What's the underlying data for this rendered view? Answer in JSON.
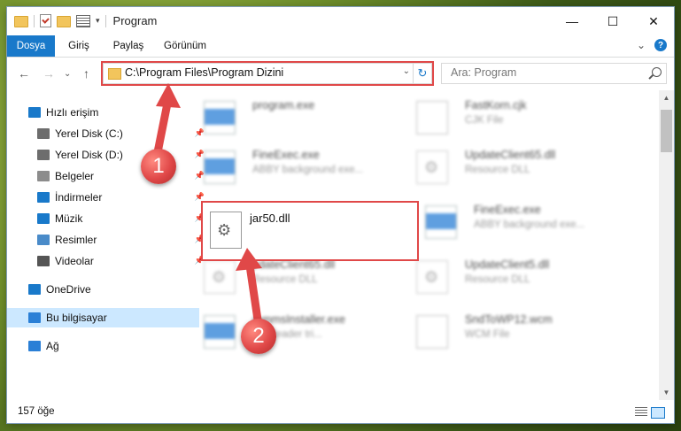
{
  "window": {
    "title": "Program",
    "controls": {
      "minimize": "—",
      "maximize": "☐",
      "close": "✕"
    }
  },
  "ribbon": {
    "tabs": [
      "Dosya",
      "Giriş",
      "Paylaş",
      "Görünüm"
    ],
    "active_tab": "Dosya",
    "expand_glyph": "⌄",
    "help_glyph": "?"
  },
  "navigation": {
    "back": "←",
    "forward": "→",
    "recent": "⌄",
    "up": "↑",
    "address": "C:\\Program Files\\Program Dizini",
    "address_drop": "⌄",
    "refresh": "↻",
    "search_placeholder": "Ara: Program"
  },
  "sidebar": {
    "items": [
      {
        "label": "Hızlı erişim",
        "icon": "star-icon",
        "color": "#1979ca",
        "pinned": false
      },
      {
        "label": "Yerel Disk (C:)",
        "icon": "drive-icon",
        "color": "#6d6d6d",
        "pinned": true
      },
      {
        "label": "Yerel Disk (D:)",
        "icon": "drive-icon",
        "color": "#6d6d6d",
        "pinned": true
      },
      {
        "label": "Belgeler",
        "icon": "documents-icon",
        "color": "#8c8c8c",
        "pinned": true
      },
      {
        "label": "İndirmeler",
        "icon": "download-icon",
        "color": "#1979ca",
        "pinned": true
      },
      {
        "label": "Müzik",
        "icon": "music-icon",
        "color": "#1979ca",
        "pinned": true
      },
      {
        "label": "Resimler",
        "icon": "pictures-icon",
        "color": "#4a8bc9",
        "pinned": true
      },
      {
        "label": "Videolar",
        "icon": "videos-icon",
        "color": "#555555",
        "pinned": true
      },
      {
        "label": "OneDrive",
        "icon": "cloud-icon",
        "color": "#1979ca",
        "pinned": false
      },
      {
        "label": "Bu bilgisayar",
        "icon": "computer-icon",
        "color": "#2a7fd6",
        "pinned": false
      },
      {
        "label": "Ağ",
        "icon": "network-icon",
        "color": "#2a7fd6",
        "pinned": false
      }
    ],
    "pin_glyph": "📌"
  },
  "files": [
    {
      "name": "program.exe",
      "desc": "",
      "icon": "exe"
    },
    {
      "name": "FastKorn.cjk",
      "desc": "CJK File",
      "icon": "doc"
    },
    {
      "name": "FineExec.exe",
      "desc": "ABBY background exe...",
      "icon": "exe"
    },
    {
      "name": "UpdateClient65.dll",
      "desc": "Resource DLL",
      "icon": "dll"
    },
    {
      "name": "FineExec.exe",
      "desc": "ABBY background exe...",
      "icon": "exe"
    },
    {
      "name": "pdateClient65.dll",
      "desc": "Resource DLL",
      "icon": "dll"
    },
    {
      "name": "UpdateClient5.dll",
      "desc": "Resource DLL",
      "icon": "dll"
    },
    {
      "name": "rammsInstaller.exe",
      "desc": "fineReader tri...",
      "icon": "exe"
    },
    {
      "name": "SndToWP12.wcm",
      "desc": "WCM File",
      "icon": "doc"
    }
  ],
  "highlighted_file": {
    "name": "jar50.dll"
  },
  "status": {
    "item_count": "157 öğe"
  },
  "annotations": {
    "step1": "1",
    "step2": "2",
    "color": "#e04848"
  }
}
